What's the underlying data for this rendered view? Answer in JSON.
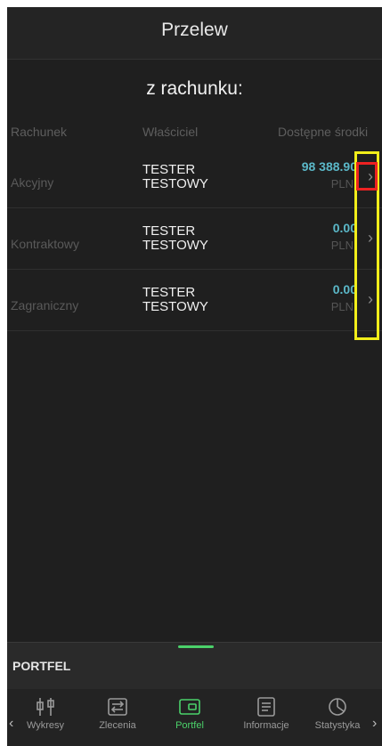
{
  "header": {
    "title": "Przelew"
  },
  "section": {
    "title": "z rachunku:"
  },
  "table": {
    "columns": [
      "Rachunek",
      "Właściciel",
      "Dostępne środki"
    ],
    "rows": [
      {
        "account": "Akcyjny",
        "owner_line1": "TESTER",
        "owner_line2": "TESTOWY",
        "amount": "98 388.90",
        "currency": "PLN"
      },
      {
        "account": "Kontraktowy",
        "owner_line1": "TESTER",
        "owner_line2": "TESTOWY",
        "amount": "0.00",
        "currency": "PLN"
      },
      {
        "account": "Zagraniczny",
        "owner_line1": "TESTER",
        "owner_line2": "TESTOWY",
        "amount": "0.00",
        "currency": "PLN"
      }
    ]
  },
  "panel": {
    "label": "PORTFEL"
  },
  "nav": {
    "items": [
      {
        "label": "Wykresy",
        "icon": "chart-candles-icon"
      },
      {
        "label": "Zlecenia",
        "icon": "swap-icon"
      },
      {
        "label": "Portfel",
        "icon": "wallet-icon"
      },
      {
        "label": "Informacje",
        "icon": "news-icon"
      },
      {
        "label": "Statystyka",
        "icon": "stats-icon"
      }
    ],
    "active_index": 2
  },
  "colors": {
    "background": "#1f1f1f",
    "accent": "#4bd16a",
    "amount": "#5bb8c8",
    "highlight_red": "#e22222",
    "highlight_yellow": "#f2ee1a"
  }
}
